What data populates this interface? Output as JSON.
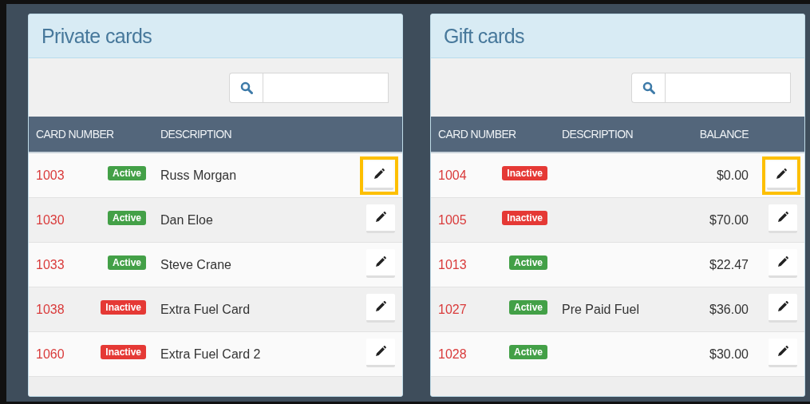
{
  "panels": [
    {
      "title": "Private cards",
      "kind": "private",
      "columns": [
        "CARD NUMBER",
        "DESCRIPTION"
      ],
      "rows": [
        {
          "number": "1003",
          "status": {
            "label": "Active",
            "active": true
          },
          "description": "Russ Morgan",
          "highlighted": true
        },
        {
          "number": "1030",
          "status": {
            "label": "Active",
            "active": true
          },
          "description": "Dan Eloe",
          "highlighted": false
        },
        {
          "number": "1033",
          "status": {
            "label": "Active",
            "active": true
          },
          "description": "Steve Crane",
          "highlighted": false
        },
        {
          "number": "1038",
          "status": {
            "label": "Inactive",
            "active": false
          },
          "description": "Extra Fuel Card",
          "highlighted": false
        },
        {
          "number": "1060",
          "status": {
            "label": "Inactive",
            "active": false
          },
          "description": "Extra Fuel Card 2",
          "highlighted": false
        }
      ]
    },
    {
      "title": "Gift cards",
      "kind": "gift",
      "columns": [
        "CARD NUMBER",
        "DESCRIPTION",
        "BALANCE"
      ],
      "rows": [
        {
          "number": "1004",
          "status": {
            "label": "Inactive",
            "active": false
          },
          "balance": "$0.00",
          "highlighted": true
        },
        {
          "number": "1005",
          "status": {
            "label": "Inactive",
            "active": false
          },
          "balance": "$70.00",
          "highlighted": false
        },
        {
          "number": "1013",
          "status": {
            "label": "Active",
            "active": true
          },
          "balance": "$22.47",
          "highlighted": false
        },
        {
          "number": "1027",
          "status": {
            "label": "Active",
            "active": true
          },
          "description": "Pre Paid Fuel",
          "balance": "$36.00",
          "highlighted": false
        },
        {
          "number": "1028",
          "status": {
            "label": "Active",
            "active": true
          },
          "balance": "$30.00",
          "highlighted": false
        }
      ]
    }
  ]
}
